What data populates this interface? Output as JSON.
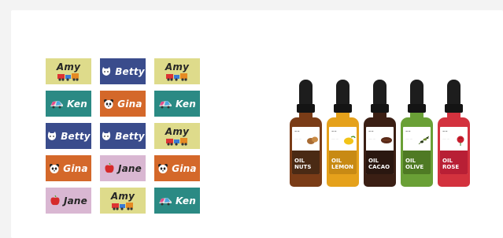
{
  "labels": [
    {
      "name": "Amy",
      "style": "yellow",
      "icon": "train-icon"
    },
    {
      "name": "Betty",
      "style": "navy",
      "icon": "cat-icon"
    },
    {
      "name": "Amy",
      "style": "yellow",
      "icon": "train-icon"
    },
    {
      "name": "Ken",
      "style": "teal",
      "icon": "car-icon"
    },
    {
      "name": "Gina",
      "style": "orange",
      "icon": "panda-icon"
    },
    {
      "name": "Ken",
      "style": "teal",
      "icon": "car-icon"
    },
    {
      "name": "Betty",
      "style": "navy",
      "icon": "cat-icon"
    },
    {
      "name": "Betty",
      "style": "navy",
      "icon": "cat-icon"
    },
    {
      "name": "Amy",
      "style": "yellow",
      "icon": "train-icon"
    },
    {
      "name": "Gina",
      "style": "orange",
      "icon": "panda-icon"
    },
    {
      "name": "Jane",
      "style": "pink",
      "icon": "apple-icon"
    },
    {
      "name": "Gina",
      "style": "orange",
      "icon": "panda-icon"
    },
    {
      "name": "Jane",
      "style": "pink",
      "icon": "apple-icon"
    },
    {
      "name": "Amy",
      "style": "yellow",
      "icon": "train-icon"
    },
    {
      "name": "Ken",
      "style": "teal",
      "icon": "car-icon"
    }
  ],
  "label_colors": {
    "yellow": "#dedb8b",
    "navy": "#3a4c8c",
    "teal": "#2b8a84",
    "orange": "#d4682a",
    "pink": "#d9b7d2"
  },
  "bottles": [
    {
      "line1": "OIL",
      "line2": "NUTS",
      "glass": "#7a3c17",
      "band": "#4a2a14",
      "fruit": "nuts-icon"
    },
    {
      "line1": "OIL",
      "line2": "LEMON",
      "glass": "#e5a11b",
      "band": "#c88a14",
      "fruit": "lemon-icon"
    },
    {
      "line1": "OIL",
      "line2": "CACAO",
      "glass": "#3b1f14",
      "band": "#2a1710",
      "fruit": "cacao-icon"
    },
    {
      "line1": "OIL",
      "line2": "OLIVE",
      "glass": "#6aa036",
      "band": "#4f7a24",
      "fruit": "olive-icon"
    },
    {
      "line1": "OIL",
      "line2": "ROSE",
      "glass": "#d3323e",
      "band": "#b81f35",
      "fruit": "rose-icon"
    }
  ]
}
